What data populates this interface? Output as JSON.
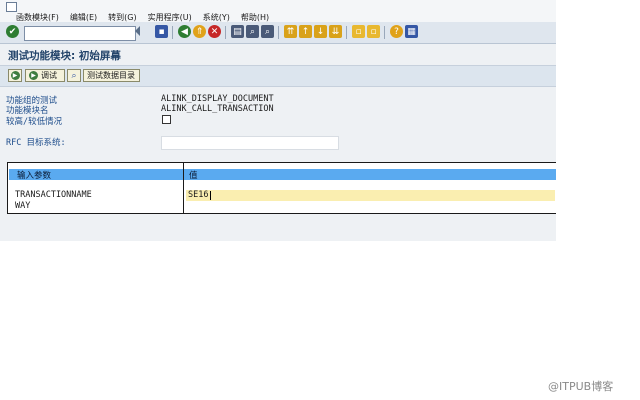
{
  "menu": [
    "函数模块(F)",
    "编辑(E)",
    "转到(G)",
    "实用程序(U)",
    "系统(Y)",
    "帮助(H)"
  ],
  "toolbar": {
    "command_field": "",
    "colors": {
      "green": "#2e7d32",
      "yellow": "#e0a21a",
      "red": "#c62828",
      "blue": "#3557a5"
    }
  },
  "title": "测试功能模块: 初始屏幕",
  "app_toolbar": {
    "debug_label": "调试",
    "test_data_dir_label": "测试数据目录"
  },
  "form": {
    "function_group_label": "功能组的测试",
    "function_group_value": "ALINK_DISPLAY_DOCUMENT",
    "function_module_label": "功能模块名",
    "function_module_value": "ALINK_CALL_TRANSACTION",
    "upper_lower_label": "较高/较低情况",
    "rfc_label": "RFC 目标系统:",
    "rfc_value": ""
  },
  "params": {
    "header_param": "输入参数",
    "header_value": "值",
    "rows": [
      {
        "name": "TRANSACTIONNAME",
        "value": "SE16"
      },
      {
        "name": "WAY",
        "value": ""
      }
    ]
  },
  "watermark": "@ITPUB博客"
}
